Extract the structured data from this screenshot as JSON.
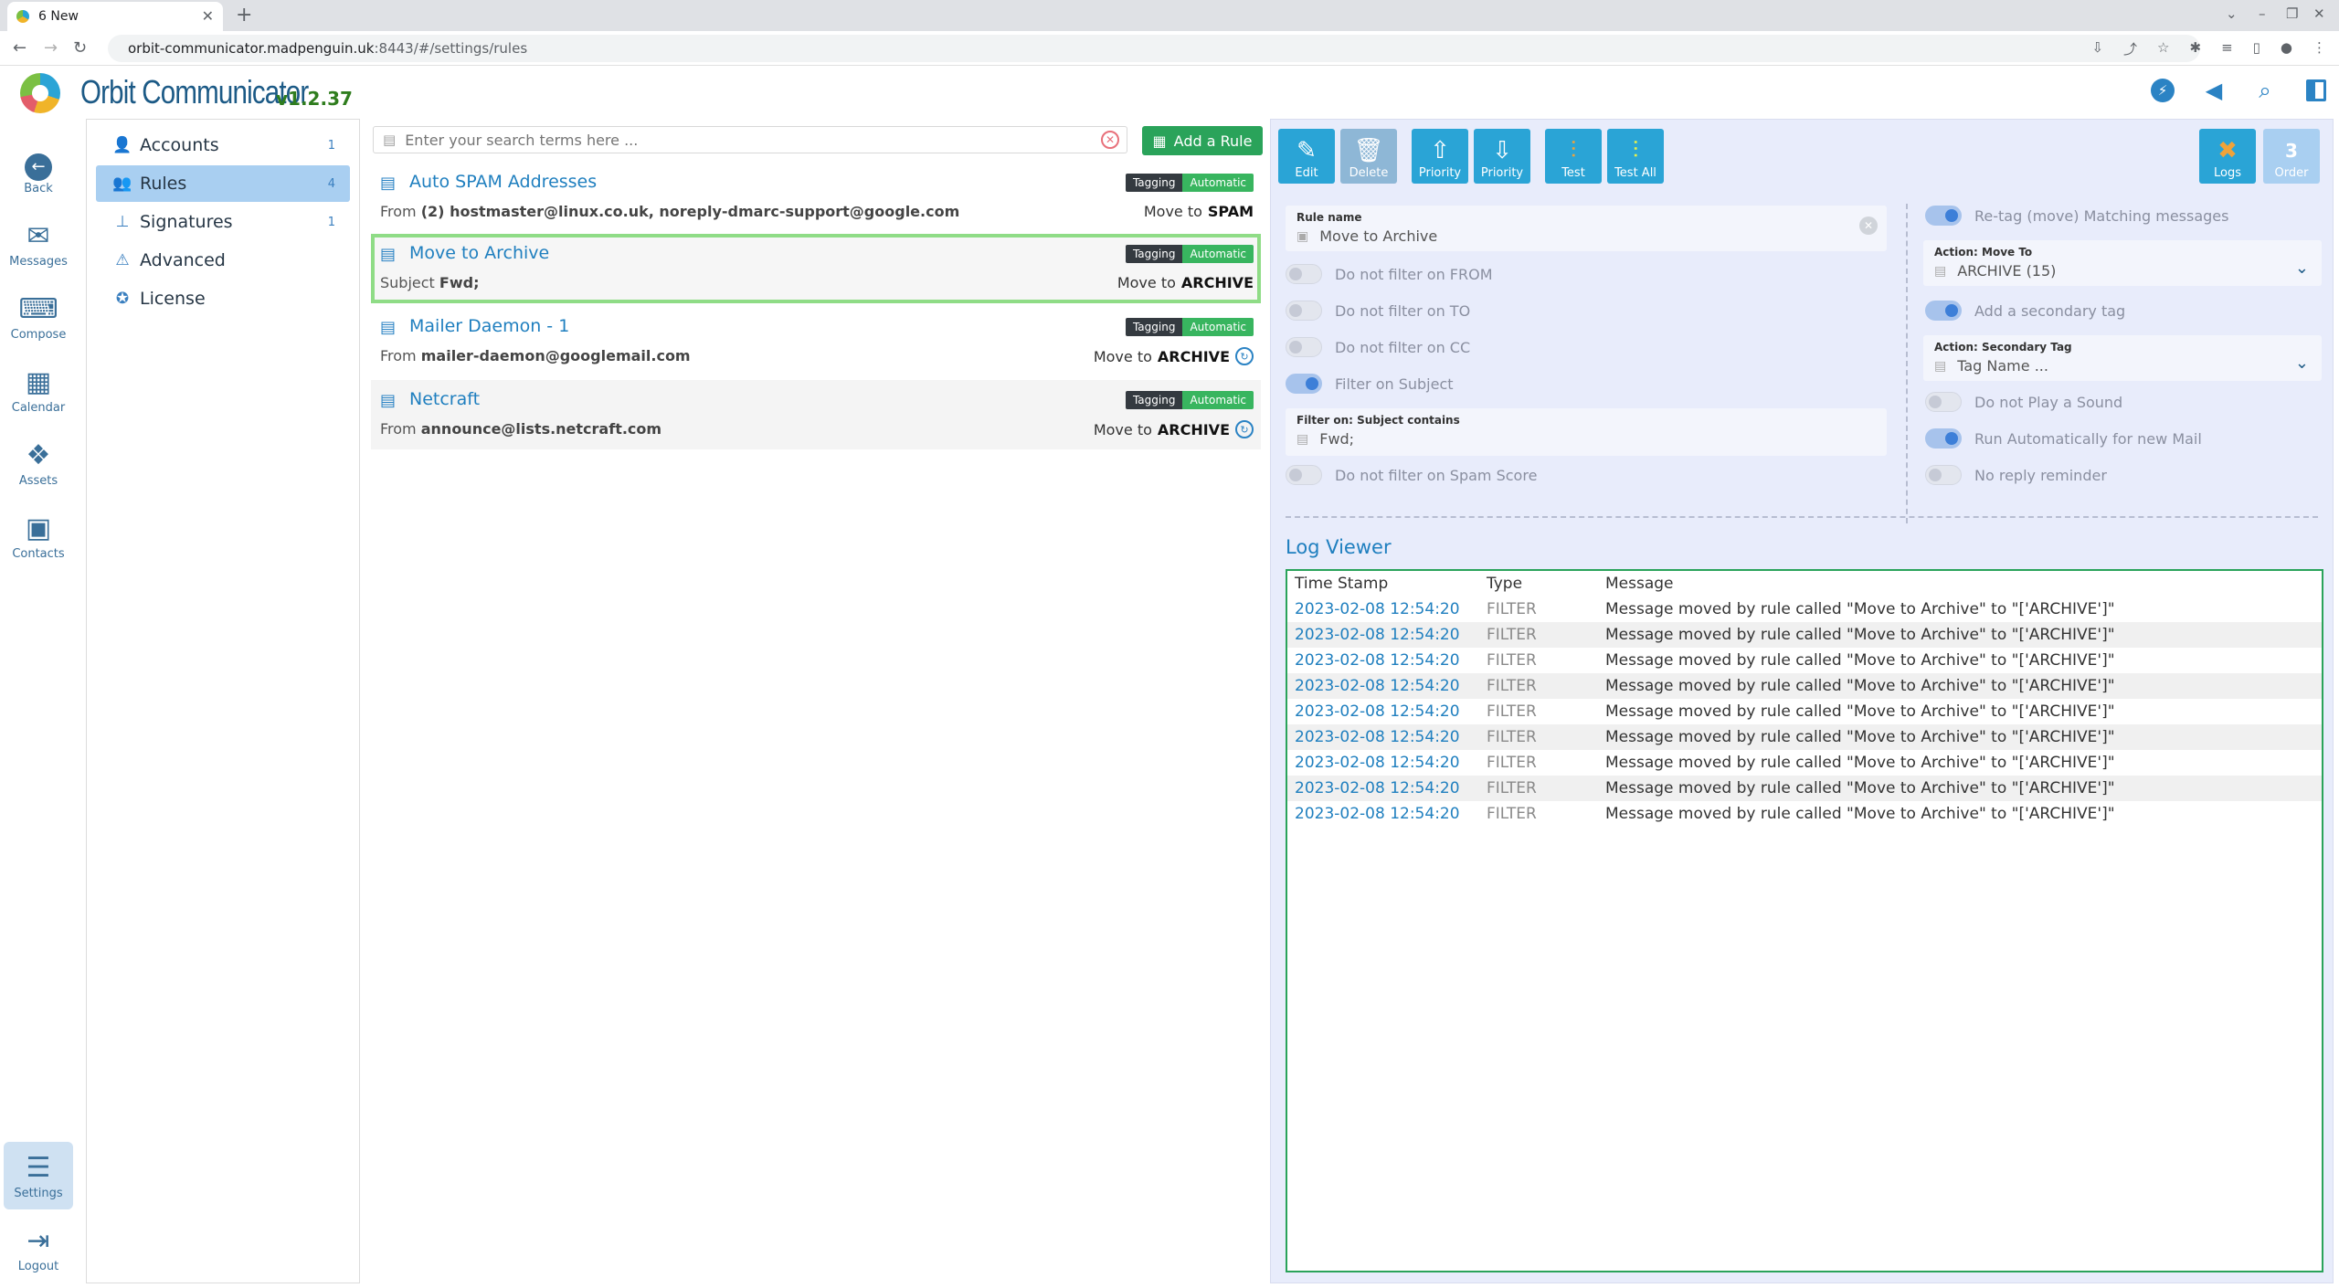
{
  "browser": {
    "tab_title": "6 New",
    "url_host": "orbit-communicator.madpenguin.uk",
    "url_path": ":8443/#/settings/rules"
  },
  "app": {
    "name": "Orbit Communicator",
    "version": "v1.2.37"
  },
  "leftnav": [
    {
      "label": "Back",
      "icon": "back-icon"
    },
    {
      "label": "Messages",
      "icon": "mail-icon"
    },
    {
      "label": "Compose",
      "icon": "keyboard-icon"
    },
    {
      "label": "Calendar",
      "icon": "calendar-icon"
    },
    {
      "label": "Assets",
      "icon": "assets-icon"
    },
    {
      "label": "Contacts",
      "icon": "contacts-icon"
    },
    {
      "label": "Settings",
      "icon": "sliders-icon"
    },
    {
      "label": "Logout",
      "icon": "logout-icon"
    }
  ],
  "settings_menu": [
    {
      "label": "Accounts",
      "count": "1"
    },
    {
      "label": "Rules",
      "count": "4"
    },
    {
      "label": "Signatures",
      "count": "1"
    },
    {
      "label": "Advanced",
      "count": ""
    },
    {
      "label": "License",
      "count": ""
    }
  ],
  "search": {
    "placeholder": "Enter your search terms here ..."
  },
  "add_rule_label": "Add a Rule",
  "rules": [
    {
      "name": "Auto SPAM Addresses",
      "filter_prefix": "From",
      "filter_value": "(2) hostmaster@linux.co.uk, noreply-dmarc-support@google.com",
      "badge_left": "Tagging",
      "badge_right": "Automatic",
      "action_prefix": "Move to",
      "action_target": "SPAM"
    },
    {
      "name": "Move to Archive",
      "filter_prefix": "Subject",
      "filter_value": "Fwd;",
      "badge_left": "Tagging",
      "badge_right": "Automatic",
      "action_prefix": "Move to",
      "action_target": "ARCHIVE"
    },
    {
      "name": "Mailer Daemon - 1",
      "filter_prefix": "From",
      "filter_value": "mailer-daemon@googlemail.com",
      "badge_left": "Tagging",
      "badge_right": "Automatic",
      "action_prefix": "Move to",
      "action_target": "ARCHIVE"
    },
    {
      "name": "Netcraft",
      "filter_prefix": "From",
      "filter_value": "announce@lists.netcraft.com",
      "badge_left": "Tagging",
      "badge_right": "Automatic",
      "action_prefix": "Move to",
      "action_target": "ARCHIVE"
    }
  ],
  "toolbar": {
    "edit": "Edit",
    "delete": "Delete",
    "priority_up": "Priority",
    "priority_down": "Priority",
    "test": "Test",
    "test_all": "Test All",
    "logs": "Logs",
    "order_label": "Order",
    "order_value": "3"
  },
  "editor": {
    "rule_name_label": "Rule name",
    "rule_name_value": "Move to Archive",
    "toggles_left": [
      {
        "label": "Do not filter on FROM",
        "on": false
      },
      {
        "label": "Do not filter on TO",
        "on": false
      },
      {
        "label": "Do not filter on CC",
        "on": false
      },
      {
        "label": "Filter on Subject",
        "on": true
      }
    ],
    "subject_label": "Filter on: Subject contains",
    "subject_value": "Fwd;",
    "spam_toggle": {
      "label": "Do not filter on Spam Score",
      "on": false
    },
    "retag": {
      "label": "Re-tag (move) Matching messages",
      "on": true
    },
    "move_to_label": "Action: Move To",
    "move_to_value": "ARCHIVE (15)",
    "secondary_toggle": {
      "label": "Add a secondary tag",
      "on": true
    },
    "secondary_label": "Action: Secondary Tag",
    "secondary_placeholder": "Tag Name ...",
    "toggles_right": [
      {
        "label": "Do not Play a Sound",
        "on": false
      },
      {
        "label": "Run Automatically for new Mail",
        "on": true
      },
      {
        "label": "No reply reminder",
        "on": false
      }
    ]
  },
  "log_viewer": {
    "title": "Log Viewer",
    "columns": [
      "Time Stamp",
      "Type",
      "Message"
    ],
    "rows": [
      {
        "ts": "2023-02-08 12:54:20",
        "type": "FILTER",
        "msg": "Message moved by rule called \"Move to Archive\" to \"['ARCHIVE']\""
      },
      {
        "ts": "2023-02-08 12:54:20",
        "type": "FILTER",
        "msg": "Message moved by rule called \"Move to Archive\" to \"['ARCHIVE']\""
      },
      {
        "ts": "2023-02-08 12:54:20",
        "type": "FILTER",
        "msg": "Message moved by rule called \"Move to Archive\" to \"['ARCHIVE']\""
      },
      {
        "ts": "2023-02-08 12:54:20",
        "type": "FILTER",
        "msg": "Message moved by rule called \"Move to Archive\" to \"['ARCHIVE']\""
      },
      {
        "ts": "2023-02-08 12:54:20",
        "type": "FILTER",
        "msg": "Message moved by rule called \"Move to Archive\" to \"['ARCHIVE']\""
      },
      {
        "ts": "2023-02-08 12:54:20",
        "type": "FILTER",
        "msg": "Message moved by rule called \"Move to Archive\" to \"['ARCHIVE']\""
      },
      {
        "ts": "2023-02-08 12:54:20",
        "type": "FILTER",
        "msg": "Message moved by rule called \"Move to Archive\" to \"['ARCHIVE']\""
      },
      {
        "ts": "2023-02-08 12:54:20",
        "type": "FILTER",
        "msg": "Message moved by rule called \"Move to Archive\" to \"['ARCHIVE']\""
      },
      {
        "ts": "2023-02-08 12:54:20",
        "type": "FILTER",
        "msg": "Message moved by rule called \"Move to Archive\" to \"['ARCHIVE']\""
      }
    ]
  },
  "colors": {
    "accent": "#2aa4d6",
    "brand": "#1c5a86",
    "success": "#2aa35a",
    "selected_border": "#8fdc86"
  }
}
